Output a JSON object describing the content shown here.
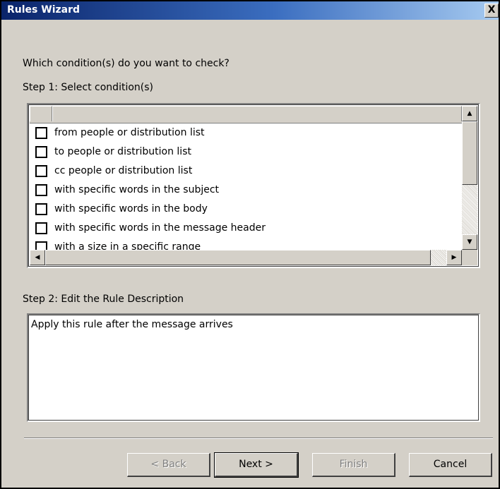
{
  "window": {
    "title": "Rules Wizard",
    "close_glyph": "X"
  },
  "prompt": "Which condition(s) do you want to check?",
  "step1": {
    "label": "Step 1: Select condition(s)",
    "conditions": [
      {
        "label": "from people or distribution list",
        "checked": false
      },
      {
        "label": "to people or distribution list",
        "checked": false
      },
      {
        "label": "cc people or distribution list",
        "checked": false
      },
      {
        "label": "with specific words in the subject",
        "checked": false
      },
      {
        "label": "with specific words in the body",
        "checked": false
      },
      {
        "label": "with specific words in the message header",
        "checked": false
      },
      {
        "label": "with a size in a specific range",
        "checked": false
      }
    ]
  },
  "step2": {
    "label": "Step 2: Edit the Rule Description",
    "description": "Apply this rule after the message arrives"
  },
  "buttons": {
    "back": "< Back",
    "next": "Next >",
    "finish": "Finish",
    "cancel": "Cancel"
  },
  "scrollbar_icons": {
    "up": "up-arrow-icon",
    "down": "down-arrow-icon",
    "left": "left-arrow-icon",
    "right": "right-arrow-icon"
  }
}
